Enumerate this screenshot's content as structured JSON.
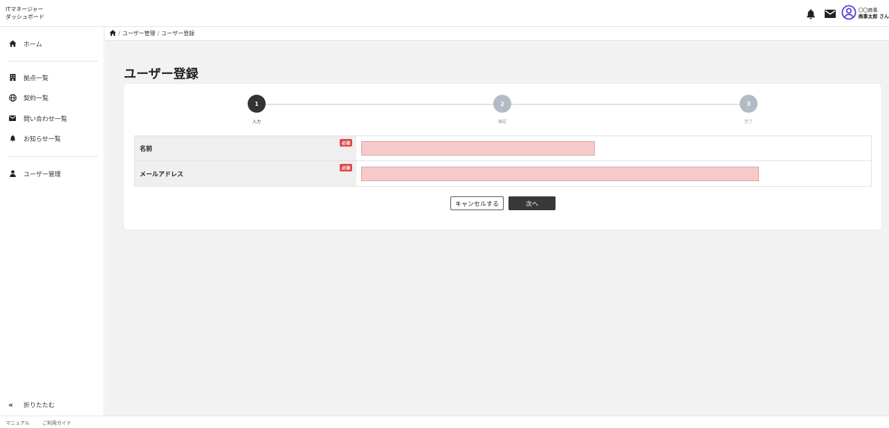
{
  "header": {
    "app_title_line1": "ITマネージャー",
    "app_title_line2": "ダッシュボード",
    "user": {
      "org": "〇〇商事",
      "name": "商事太郎 さん"
    }
  },
  "sidebar": {
    "items": [
      {
        "label": "ホーム",
        "icon": "home-icon"
      },
      {
        "label": "拠点一覧",
        "icon": "building-icon"
      },
      {
        "label": "契約一覧",
        "icon": "globe-icon"
      },
      {
        "label": "問い合わせ一覧",
        "icon": "envelope-icon"
      },
      {
        "label": "お知らせ一覧",
        "icon": "bell-icon"
      },
      {
        "label": "ユーザー管理",
        "icon": "user-icon"
      }
    ],
    "collapse_label": "折りたたむ"
  },
  "breadcrumb": {
    "items": [
      "ユーザー管理",
      "ユーザー登録"
    ],
    "separator": "/"
  },
  "page": {
    "title": "ユーザー登録"
  },
  "stepper": {
    "steps": [
      {
        "number": "1",
        "label": "入力",
        "active": true
      },
      {
        "number": "2",
        "label": "確認",
        "active": false
      },
      {
        "number": "3",
        "label": "完了",
        "active": false
      }
    ],
    "active_color": "#333333",
    "inactive_color": "#b3bcc6"
  },
  "form": {
    "required_badge": "必須",
    "fields": [
      {
        "label": "名前",
        "value": "",
        "placeholder": ""
      },
      {
        "label": "メールアドレス",
        "value": "",
        "placeholder": ""
      }
    ],
    "error_color": "#f6caca"
  },
  "buttons": {
    "cancel": "キャンセルする",
    "next": "次へ"
  },
  "footer": {
    "manual": "マニュアル",
    "guide": "ご利用ガイド"
  }
}
